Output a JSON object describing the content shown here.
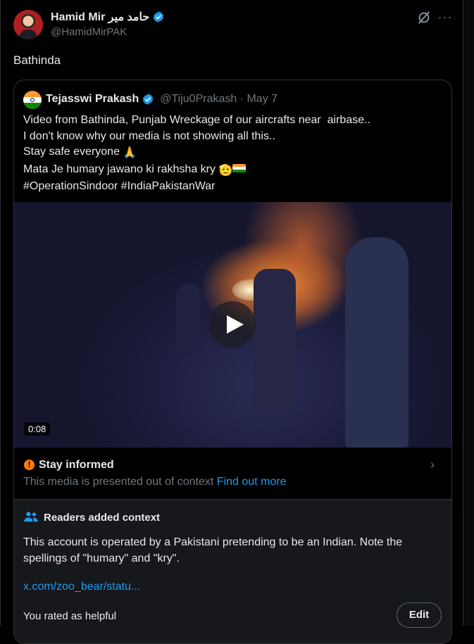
{
  "tweet": {
    "author_name": "Hamid Mir حامد میر",
    "handle": "@HamidMirPAK",
    "text": "Bathinda",
    "more_label": "···"
  },
  "quote": {
    "author_name": "Tejasswi Prakash",
    "handle_date": "@Tiju0Prakash · May 7",
    "lines": [
      "Video from Bathinda, Punjab Wreckage of our aircrafts near  airbase..",
      "I don't know why our media is not showing all this..",
      "Stay safe everyone",
      "Mata Je humary jawano ki rakhsha kry",
      "#OperationSindoor #IndiaPakistanWar"
    ],
    "emojis": {
      "pray": "🙏",
      "salute": "🫡"
    },
    "video_duration": "0:08"
  },
  "notice": {
    "title": "Stay informed",
    "description": "This media is presented out of context",
    "link": "Find out more",
    "icon_glyph": "!",
    "chevron": "›"
  },
  "context": {
    "title": "Readers added context",
    "text": "This account is operated by a Pakistani pretending to be an Indian. Note the spellings of \"humary\" and \"kry\".",
    "link": "x.com/zoo_bear/statu...",
    "rated": "You rated as helpful",
    "edit_label": "Edit"
  },
  "colors": {
    "background": "#000000",
    "text": "#e7e9ea",
    "muted": "#71767b",
    "accent": "#1d9bf0",
    "verified": "#1d9bf0",
    "notice_icon": "#ff7a00"
  },
  "icons": [
    "verified-badge-icon",
    "grok-icon",
    "more-icon",
    "play-icon",
    "alert-icon",
    "chevron-right-icon",
    "people-icon"
  ]
}
